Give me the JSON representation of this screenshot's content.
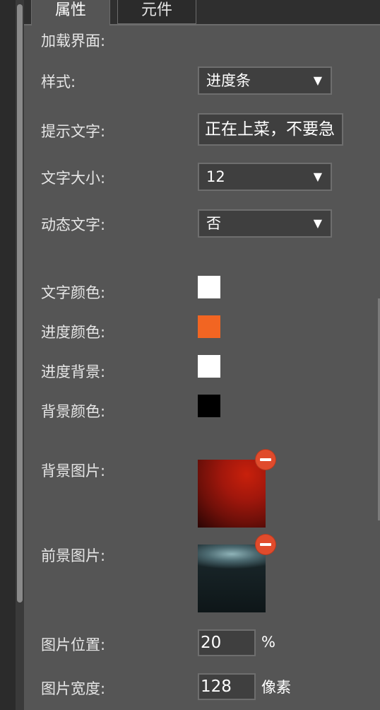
{
  "tabs": [
    {
      "label": "属性",
      "active": true
    },
    {
      "label": "元件",
      "active": false
    }
  ],
  "section_title": "加载界面:",
  "style": {
    "label": "样式:",
    "value": "进度条"
  },
  "hint_text": {
    "label": "提示文字:",
    "value": "正在上菜，不要急"
  },
  "font_size": {
    "label": "文字大小:",
    "value": "12"
  },
  "dynamic_text": {
    "label": "动态文字:",
    "value": "否"
  },
  "colors": {
    "text_color": {
      "label": "文字颜色:",
      "value": "#ffffff"
    },
    "progress_color": {
      "label": "进度颜色:",
      "value": "#f26522"
    },
    "progress_bg": {
      "label": "进度背景:",
      "value": "#ffffff"
    },
    "bg_color": {
      "label": "背景颜色:",
      "value": "#000000"
    }
  },
  "bg_image": {
    "label": "背景图片:"
  },
  "fg_image": {
    "label": "前景图片:"
  },
  "image_position": {
    "label": "图片位置:",
    "value": "20",
    "unit": "%"
  },
  "image_width": {
    "label": "图片宽度:",
    "value": "128",
    "unit": "像素"
  },
  "icons": {
    "dropdown": "triangle-down",
    "remove": "minus-circle"
  }
}
